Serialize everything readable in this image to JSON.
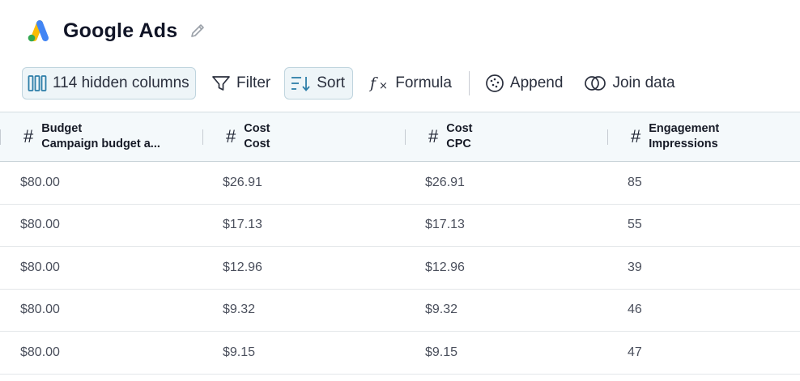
{
  "header": {
    "title": "Google Ads",
    "logo_icon": "google-ads-logo",
    "edit_icon": "pencil-icon"
  },
  "toolbar": {
    "hidden_columns_label": "114 hidden columns",
    "filter_label": "Filter",
    "sort_label": "Sort",
    "formula_label": "Formula",
    "append_label": "Append",
    "join_label": "Join data"
  },
  "table": {
    "columns": [
      {
        "type_icon": "#",
        "group": "Budget",
        "name": "Campaign budget a..."
      },
      {
        "type_icon": "#",
        "group": "Cost",
        "name": "Cost"
      },
      {
        "type_icon": "#",
        "group": "Cost",
        "name": "CPC"
      },
      {
        "type_icon": "#",
        "group": "Engagement",
        "name": "Impressions"
      }
    ],
    "rows": [
      [
        "$80.00",
        "$26.91",
        "$26.91",
        "85"
      ],
      [
        "$80.00",
        "$17.13",
        "$17.13",
        "55"
      ],
      [
        "$80.00",
        "$12.96",
        "$12.96",
        "39"
      ],
      [
        "$80.00",
        "$9.32",
        "$9.32",
        "46"
      ],
      [
        "$80.00",
        "$9.15",
        "$9.15",
        "47"
      ]
    ]
  },
  "colors": {
    "accent": "#2d7ea8",
    "google_blue": "#4285f4",
    "google_yellow": "#fbbc04",
    "google_green": "#34a853"
  }
}
